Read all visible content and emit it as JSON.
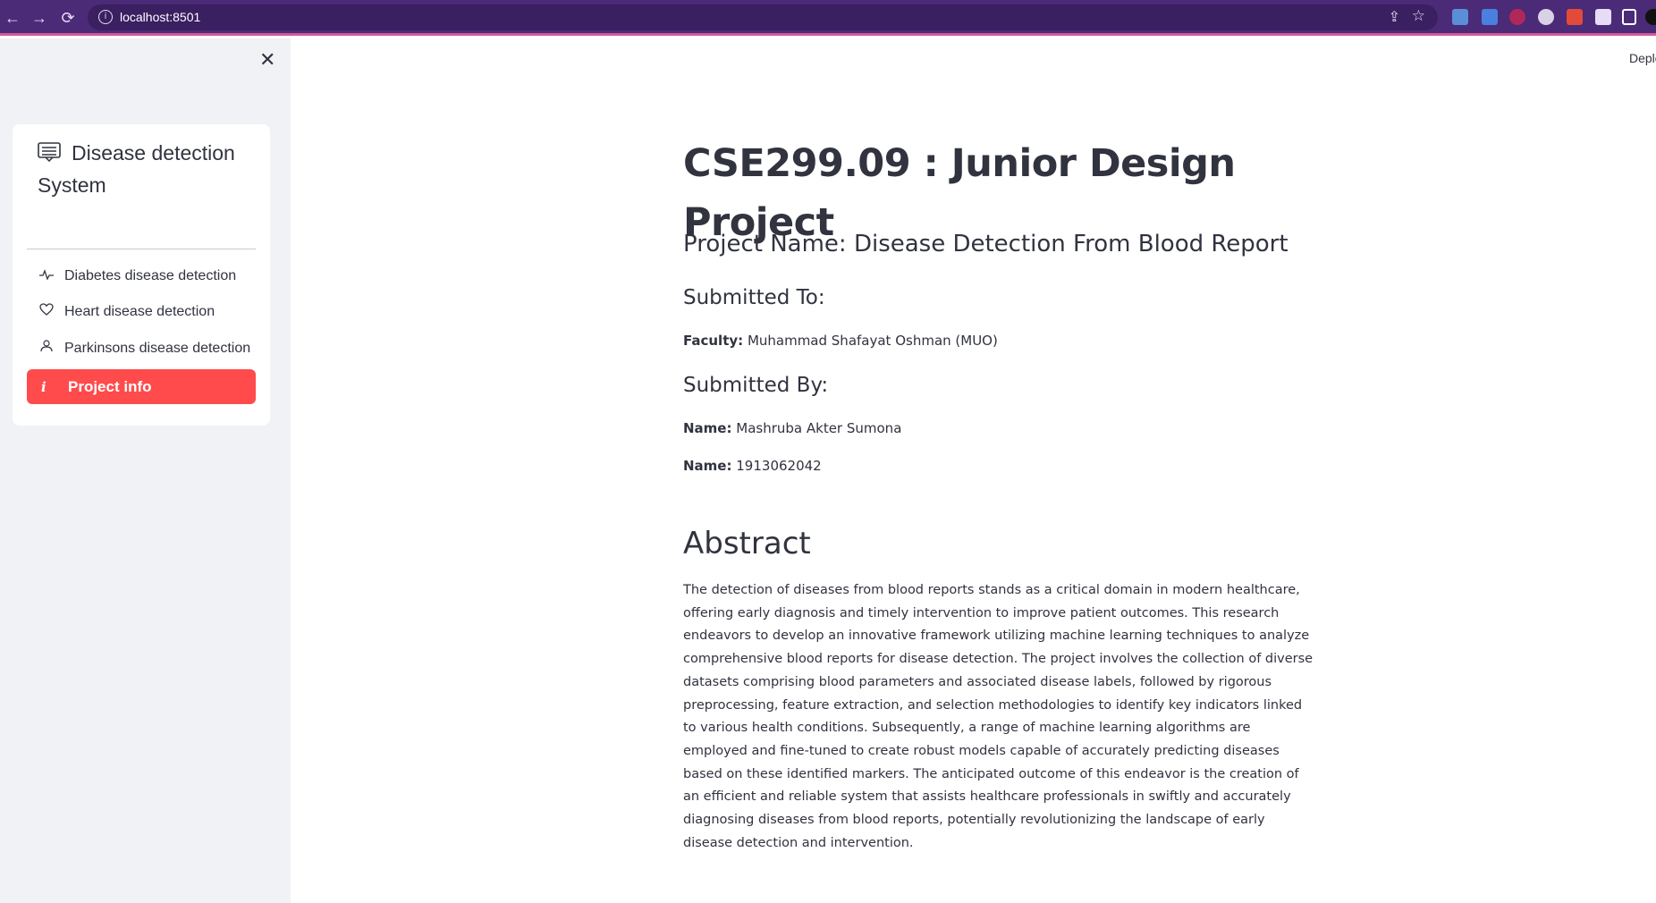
{
  "browser": {
    "url": "localhost:8501"
  },
  "sidebar": {
    "title": "Disease detection System",
    "items": [
      {
        "label": "Diabetes disease detection",
        "icon": "activity-icon"
      },
      {
        "label": "Heart disease detection",
        "icon": "heart-icon"
      },
      {
        "label": "Parkinsons disease detection",
        "icon": "person-icon"
      },
      {
        "label": "Project info",
        "icon": "info-icon",
        "active": true
      }
    ]
  },
  "header": {
    "deploy_label": "Deplo"
  },
  "main": {
    "title": "CSE299.09 : Junior Design Project",
    "project_name": "Project Name: Disease Detection From Blood Report",
    "submitted_to_heading": "Submitted To:",
    "faculty_label": "Faculty:",
    "faculty_value": "Muhammad Shafayat Oshman (MUO)",
    "submitted_by_heading": "Submitted By:",
    "name_label_1": "Name:",
    "name_value_1": "Mashruba Akter Sumona",
    "name_label_2": "Name:",
    "name_value_2": "1913062042",
    "abstract_heading": "Abstract",
    "abstract_text": "The detection of diseases from blood reports stands as a critical domain in modern healthcare, offering early diagnosis and timely intervention to improve patient outcomes. This research endeavors to develop an innovative framework utilizing machine learning techniques to analyze comprehensive blood reports for disease detection. The project involves the collection of diverse datasets comprising blood parameters and associated disease labels, followed by rigorous preprocessing, feature extraction, and selection methodologies to identify key indicators linked to various health conditions. Subsequently, a range of machine learning algorithms are employed and fine-tuned to create robust models capable of accurately predicting diseases based on these identified markers. The anticipated outcome of this endeavor is the creation of an efficient and reliable system that assists healthcare professionals in swiftly and accurately diagnosing diseases from blood reports, potentially revolutionizing the landscape of early disease detection and intervention."
  },
  "colors": {
    "browser_bar": "#4b2a78",
    "sidebar_bg": "#f0f2f6",
    "active_item": "#ff4b4b",
    "text": "#31333f"
  }
}
